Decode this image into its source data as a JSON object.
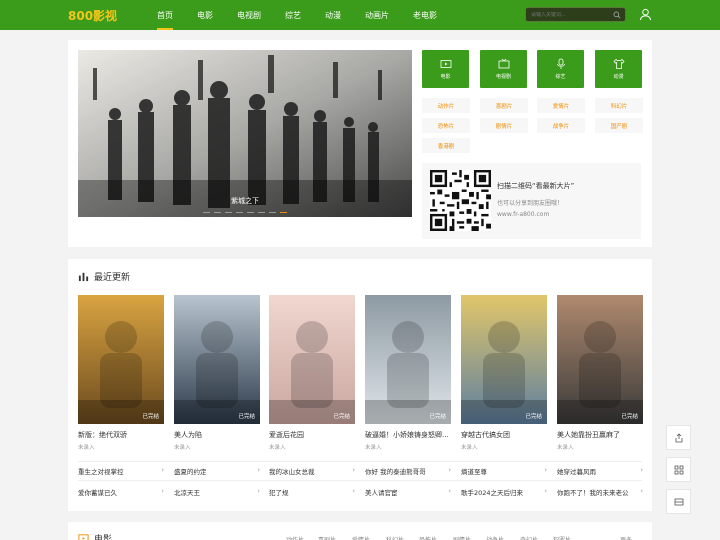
{
  "header": {
    "logo": "800影视",
    "nav": [
      "首页",
      "电影",
      "电视剧",
      "综艺",
      "动漫",
      "动画片",
      "老电影"
    ],
    "search_placeholder": "请输入关键词..."
  },
  "banner": {
    "caption": "紫城之下",
    "slide_count": 8,
    "active_slide": 7
  },
  "categories": [
    {
      "label": "电影",
      "icon": "film-icon"
    },
    {
      "label": "电视剧",
      "icon": "tv-icon"
    },
    {
      "label": "综艺",
      "icon": "mic-icon"
    },
    {
      "label": "动漫",
      "icon": "shirt-icon"
    }
  ],
  "tags": [
    "动作片",
    "喜剧片",
    "爱情片",
    "科幻片",
    "恐怖片",
    "剧情片",
    "战争片",
    "国产剧",
    "香港剧"
  ],
  "qr": {
    "title": "扫描二维码“看最新大片”",
    "subtitle": "也可以分享到朋友圈哦！",
    "url": "www.fr-a800.com"
  },
  "latest": {
    "heading": "最近更新",
    "items": [
      {
        "title": "新版：绝代双骄",
        "sub": "未录入",
        "badge": "已完结",
        "color1": "#6b4a1e",
        "color2": "#d9a441"
      },
      {
        "title": "美人为陷",
        "sub": "未录入",
        "badge": "已完结",
        "color1": "#2c3a4a",
        "color2": "#b8c4cf"
      },
      {
        "title": "爱逝后花园",
        "sub": "未录入",
        "badge": "已完结",
        "color1": "#caa6a0",
        "color2": "#f0d7cf"
      },
      {
        "title": "破逼婚！小娇娘铸身怒卿...",
        "sub": "未录入",
        "badge": "已完结",
        "color1": "#dfe6ea",
        "color2": "#8e9aa3"
      },
      {
        "title": "穿越古代搞女团",
        "sub": "未录入",
        "badge": "已完结",
        "color1": "#5d7fa0",
        "color2": "#e1c66a"
      },
      {
        "title": "美人她靠扮丑赢麻了",
        "sub": "未录入",
        "badge": "已完结",
        "color1": "#3a3a3a",
        "color2": "#b08a6e"
      }
    ],
    "links_row1": [
      "重生之对视掌控",
      "盛夏的约定",
      "我的冰山女总裁",
      "你好 我的泰迪熊哥哥",
      "熵道至尊",
      "她穿过暮风雨"
    ],
    "links_row2": [
      "爱你蓄谋已久",
      "北凉天王",
      "犯了规",
      "美人请官宦",
      "歌手2024之天后归来",
      "你跑不了！我的未来老公"
    ]
  },
  "movies": {
    "heading": "电影",
    "subcats": [
      "动作片",
      "喜剧片",
      "爱情片",
      "科幻片",
      "恐怖片",
      "剧情片",
      "战争片",
      "奇幻片",
      "犯罪片",
      "更多"
    ]
  },
  "colors": {
    "brand_green": "#3a9c1a",
    "accent_orange": "#f08c00",
    "logo_yellow": "#f5c518"
  }
}
